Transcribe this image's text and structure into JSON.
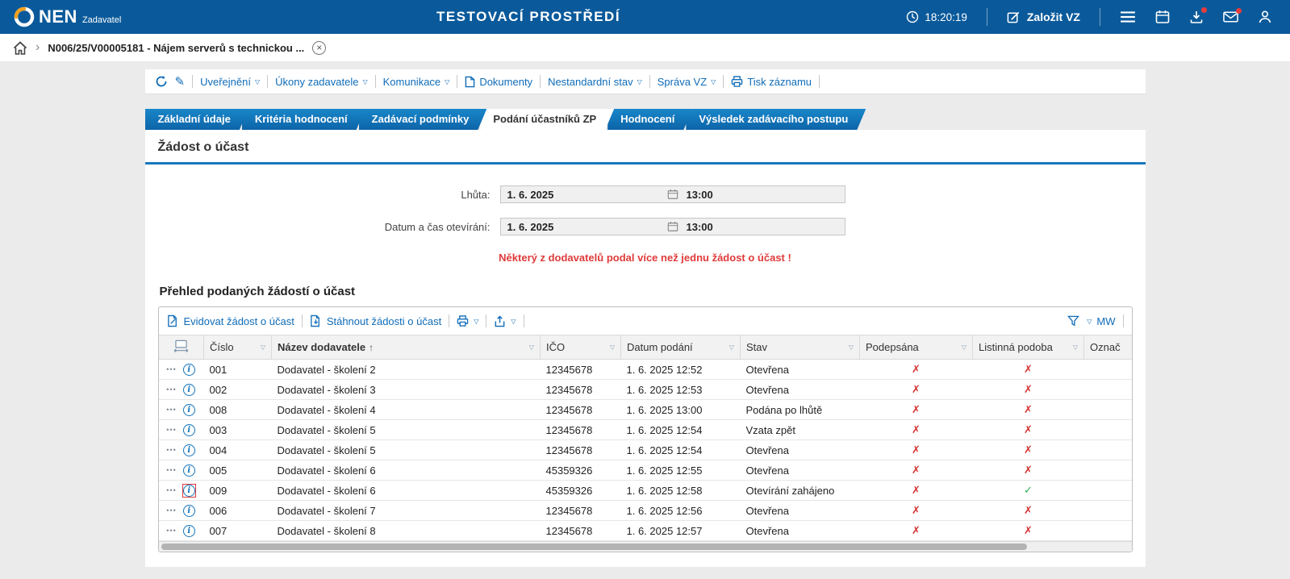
{
  "topbar": {
    "logo": "NEN",
    "logo_sub": "Zadavatel",
    "env_title": "TESTOVACÍ PROSTŘEDÍ",
    "time": "18:20:19",
    "create_button": "Založit VZ"
  },
  "breadcrumb": {
    "item": "N006/25/V00005181 - Nájem serverů s technickou ..."
  },
  "toolbar": {
    "items": [
      {
        "label": "Uveřejnění"
      },
      {
        "label": "Úkony zadavatele"
      },
      {
        "label": "Komunikace"
      },
      {
        "label": "Dokumenty"
      },
      {
        "label": "Nestandardní stav"
      },
      {
        "label": "Správa VZ"
      },
      {
        "label": "Tisk záznamu"
      }
    ]
  },
  "tabs": [
    {
      "label": "Základní údaje",
      "active": false
    },
    {
      "label": "Kritéria hodnocení",
      "active": false
    },
    {
      "label": "Zadávací podmínky",
      "active": false
    },
    {
      "label": "Podání účastníků ZP",
      "active": true
    },
    {
      "label": "Hodnocení",
      "active": false
    },
    {
      "label": "Výsledek zadávacího postupu",
      "active": false
    }
  ],
  "section": {
    "title": "Žádost o účast",
    "fields": [
      {
        "label": "Lhůta:",
        "date": "1. 6. 2025",
        "time": "13:00"
      },
      {
        "label": "Datum a čas otevírání:",
        "date": "1. 6. 2025",
        "time": "13:00"
      }
    ],
    "warning": "Některý z dodavatelů podal více než jednu žádost o účast !"
  },
  "grid": {
    "title": "Přehled podaných žádostí o účast",
    "actions": {
      "evidovat": "Evidovat žádost o účast",
      "stahnout": "Stáhnout žádosti o účast",
      "layout": "MW"
    },
    "columns": [
      {
        "label": "Číslo"
      },
      {
        "label": "Název dodavatele",
        "sorted": "asc"
      },
      {
        "label": "IČO"
      },
      {
        "label": "Datum podání"
      },
      {
        "label": "Stav"
      },
      {
        "label": "Podepsána"
      },
      {
        "label": "Listinná podoba"
      },
      {
        "label": "Označ"
      }
    ],
    "rows": [
      {
        "cislo": "001",
        "nazev": "Dodavatel - školení 2",
        "ico": "12345678",
        "datum": "1. 6. 2025 12:52",
        "stav": "Otevřena",
        "podepsana": "✗",
        "listinna": "✗",
        "highlight": false
      },
      {
        "cislo": "002",
        "nazev": "Dodavatel - školení 3",
        "ico": "12345678",
        "datum": "1. 6. 2025 12:53",
        "stav": "Otevřena",
        "podepsana": "✗",
        "listinna": "✗",
        "highlight": false
      },
      {
        "cislo": "008",
        "nazev": "Dodavatel - školení 4",
        "ico": "12345678",
        "datum": "1. 6. 2025 13:00",
        "stav": "Podána po lhůtě",
        "podepsana": "✗",
        "listinna": "✗",
        "highlight": false
      },
      {
        "cislo": "003",
        "nazev": "Dodavatel - školení 5",
        "ico": "12345678",
        "datum": "1. 6. 2025 12:54",
        "stav": "Vzata zpět",
        "podepsana": "✗",
        "listinna": "✗",
        "highlight": false
      },
      {
        "cislo": "004",
        "nazev": "Dodavatel - školení 5",
        "ico": "12345678",
        "datum": "1. 6. 2025 12:54",
        "stav": "Otevřena",
        "podepsana": "✗",
        "listinna": "✗",
        "highlight": false
      },
      {
        "cislo": "005",
        "nazev": "Dodavatel - školení 6",
        "ico": "45359326",
        "datum": "1. 6. 2025 12:55",
        "stav": "Otevřena",
        "podepsana": "✗",
        "listinna": "✗",
        "highlight": false
      },
      {
        "cislo": "009",
        "nazev": "Dodavatel - školení 6",
        "ico": "45359326",
        "datum": "1. 6. 2025 12:58",
        "stav": "Otevírání zahájeno",
        "podepsana": "✗",
        "listinna": "✓",
        "highlight": true
      },
      {
        "cislo": "006",
        "nazev": "Dodavatel - školení 7",
        "ico": "12345678",
        "datum": "1. 6. 2025 12:56",
        "stav": "Otevřena",
        "podepsana": "✗",
        "listinna": "✗",
        "highlight": false
      },
      {
        "cislo": "007",
        "nazev": "Dodavatel - školení 8",
        "ico": "12345678",
        "datum": "1. 6. 2025 12:57",
        "stav": "Otevřena",
        "podepsana": "✗",
        "listinna": "✗",
        "highlight": false
      }
    ]
  },
  "icons": {
    "caret": "▽",
    "sort_asc": "↑",
    "row_menu": "•••",
    "info": "i",
    "close": "×",
    "chevron": "›",
    "pencil": "✎",
    "check": "✓",
    "cross": "✗"
  },
  "colors": {
    "brand_blue": "#0a5a9b",
    "tab_blue": "#0f6fb4",
    "link_blue": "#0f6cb8",
    "warning_red": "#e03a3a",
    "cross_red": "#d63333",
    "check_green": "#2eaf4e",
    "logo_orange": "#f5a11c"
  }
}
